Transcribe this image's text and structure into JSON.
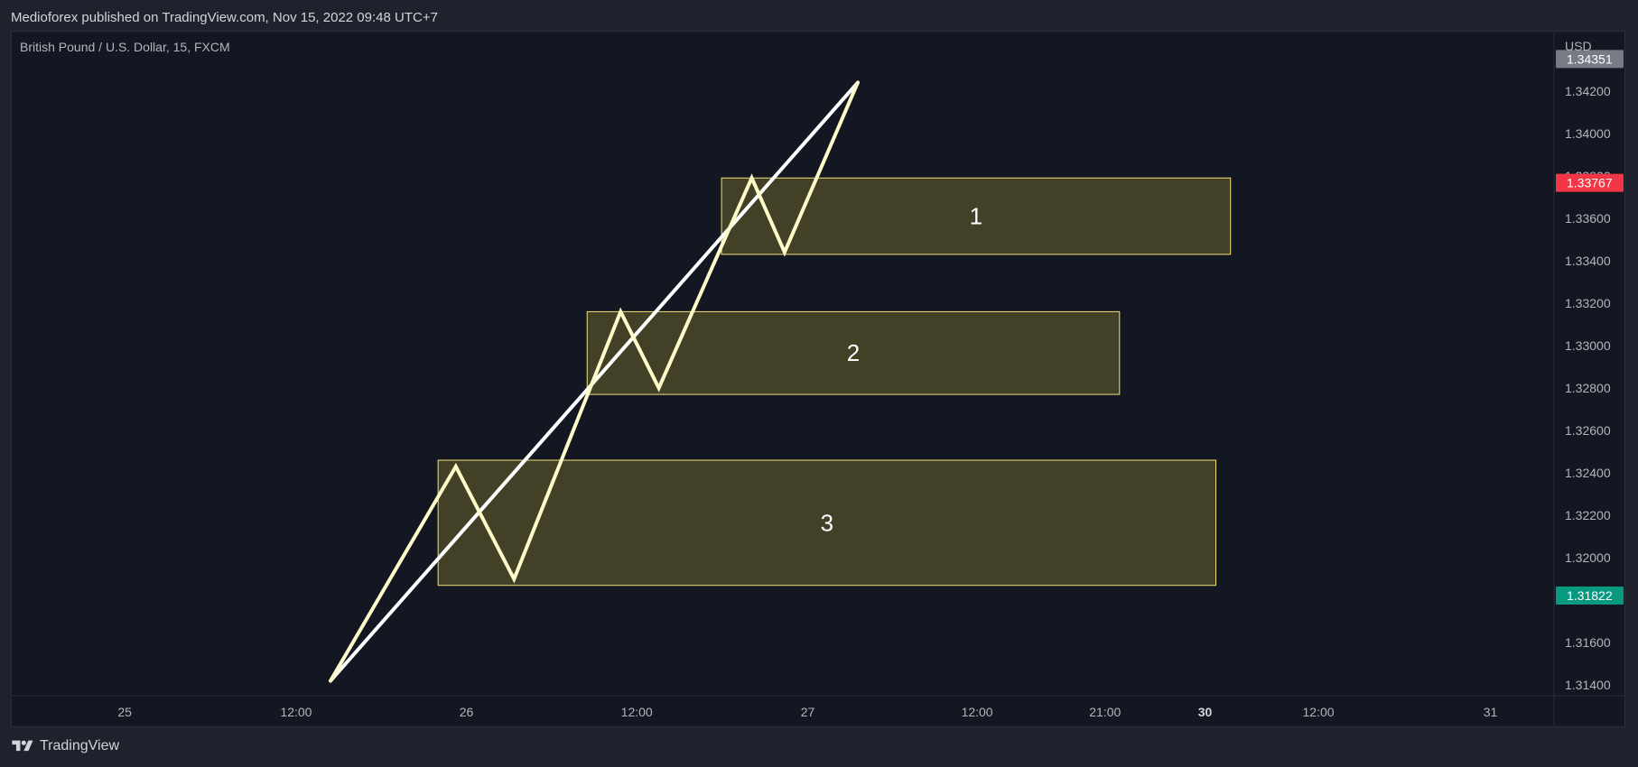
{
  "publish_info": "Medioforex published on TradingView.com, Nov 15, 2022 09:48 UTC+7",
  "brand": {
    "name": "TradingView",
    "logo_icon": "tradingview-logo-icon"
  },
  "chart_data": {
    "type": "line",
    "title": "British Pound / U.S. Dollar, 15, FXCM",
    "currency": "USD",
    "ylim": [
      1.3135,
      1.3448
    ],
    "y_ticks": [
      1.342,
      1.34,
      1.338,
      1.336,
      1.334,
      1.332,
      1.33,
      1.328,
      1.326,
      1.324,
      1.322,
      1.32,
      1.316,
      1.314
    ],
    "y_tick_labels": [
      "1.34200",
      "1.34000",
      "1.33800",
      "1.33600",
      "1.33400",
      "1.33200",
      "1.33000",
      "1.32800",
      "1.32600",
      "1.32400",
      "1.32200",
      "1.32000",
      "1.31600",
      "1.31400"
    ],
    "x_ticks": [
      {
        "label": "25",
        "pos": 0.0733,
        "bold": false
      },
      {
        "label": "12:00",
        "pos": 0.1845,
        "bold": false
      },
      {
        "label": "26",
        "pos": 0.295,
        "bold": false
      },
      {
        "label": "12:00",
        "pos": 0.4055,
        "bold": false
      },
      {
        "label": "27",
        "pos": 0.5164,
        "bold": false
      },
      {
        "label": "12:00",
        "pos": 0.6263,
        "bold": false
      },
      {
        "label": "21:00",
        "pos": 0.7093,
        "bold": false
      },
      {
        "label": "30",
        "pos": 0.7742,
        "bold": true
      },
      {
        "label": "12:00",
        "pos": 0.8477,
        "bold": false
      },
      {
        "label": "31",
        "pos": 0.9593,
        "bold": false
      }
    ],
    "price_markers": [
      {
        "value": "1.34351",
        "color": "#787b86"
      },
      {
        "value": "1.33767",
        "color": "#f23645"
      },
      {
        "value": "1.31822",
        "color": "#089981"
      }
    ],
    "zones": [
      {
        "label": "1",
        "x0": 0.4605,
        "x1": 0.7907,
        "top": 1.3379,
        "bottom": 1.3343
      },
      {
        "label": "2",
        "x0": 0.3733,
        "x1": 0.7187,
        "top": 1.3316,
        "bottom": 1.3277
      },
      {
        "label": "3",
        "x0": 0.2766,
        "x1": 0.7812,
        "top": 1.3246,
        "bottom": 1.3187
      }
    ],
    "trendline": [
      {
        "x": 0.2068,
        "y": 1.3142
      },
      {
        "x": 0.5489,
        "y": 1.3424
      }
    ],
    "path": [
      {
        "x": 0.2068,
        "y": 1.3142
      },
      {
        "x": 0.2881,
        "y": 1.3243
      },
      {
        "x": 0.3259,
        "y": 1.319
      },
      {
        "x": 0.395,
        "y": 1.3316
      },
      {
        "x": 0.4198,
        "y": 1.328
      },
      {
        "x": 0.4801,
        "y": 1.3379
      },
      {
        "x": 0.5014,
        "y": 1.3344
      },
      {
        "x": 0.5489,
        "y": 1.3424
      }
    ],
    "colors": {
      "zone_fill": "rgba(255,235,59,0.2)",
      "zone_border": "#f3e17a",
      "trendline": "#ffffff",
      "path": "#fffbc8",
      "text": "#b2b5be",
      "grid_border": "#2a2e39"
    }
  }
}
